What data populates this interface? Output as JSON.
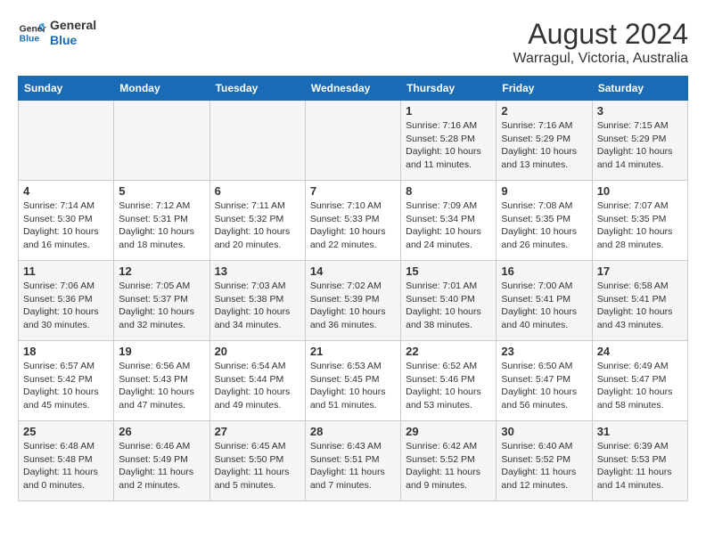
{
  "logo": {
    "line1": "General",
    "line2": "Blue"
  },
  "title": "August 2024",
  "subtitle": "Warragul, Victoria, Australia",
  "days_of_week": [
    "Sunday",
    "Monday",
    "Tuesday",
    "Wednesday",
    "Thursday",
    "Friday",
    "Saturday"
  ],
  "weeks": [
    [
      {
        "day": "",
        "info": ""
      },
      {
        "day": "",
        "info": ""
      },
      {
        "day": "",
        "info": ""
      },
      {
        "day": "",
        "info": ""
      },
      {
        "day": "1",
        "info": "Sunrise: 7:16 AM\nSunset: 5:28 PM\nDaylight: 10 hours\nand 11 minutes."
      },
      {
        "day": "2",
        "info": "Sunrise: 7:16 AM\nSunset: 5:29 PM\nDaylight: 10 hours\nand 13 minutes."
      },
      {
        "day": "3",
        "info": "Sunrise: 7:15 AM\nSunset: 5:29 PM\nDaylight: 10 hours\nand 14 minutes."
      }
    ],
    [
      {
        "day": "4",
        "info": "Sunrise: 7:14 AM\nSunset: 5:30 PM\nDaylight: 10 hours\nand 16 minutes."
      },
      {
        "day": "5",
        "info": "Sunrise: 7:12 AM\nSunset: 5:31 PM\nDaylight: 10 hours\nand 18 minutes."
      },
      {
        "day": "6",
        "info": "Sunrise: 7:11 AM\nSunset: 5:32 PM\nDaylight: 10 hours\nand 20 minutes."
      },
      {
        "day": "7",
        "info": "Sunrise: 7:10 AM\nSunset: 5:33 PM\nDaylight: 10 hours\nand 22 minutes."
      },
      {
        "day": "8",
        "info": "Sunrise: 7:09 AM\nSunset: 5:34 PM\nDaylight: 10 hours\nand 24 minutes."
      },
      {
        "day": "9",
        "info": "Sunrise: 7:08 AM\nSunset: 5:35 PM\nDaylight: 10 hours\nand 26 minutes."
      },
      {
        "day": "10",
        "info": "Sunrise: 7:07 AM\nSunset: 5:35 PM\nDaylight: 10 hours\nand 28 minutes."
      }
    ],
    [
      {
        "day": "11",
        "info": "Sunrise: 7:06 AM\nSunset: 5:36 PM\nDaylight: 10 hours\nand 30 minutes."
      },
      {
        "day": "12",
        "info": "Sunrise: 7:05 AM\nSunset: 5:37 PM\nDaylight: 10 hours\nand 32 minutes."
      },
      {
        "day": "13",
        "info": "Sunrise: 7:03 AM\nSunset: 5:38 PM\nDaylight: 10 hours\nand 34 minutes."
      },
      {
        "day": "14",
        "info": "Sunrise: 7:02 AM\nSunset: 5:39 PM\nDaylight: 10 hours\nand 36 minutes."
      },
      {
        "day": "15",
        "info": "Sunrise: 7:01 AM\nSunset: 5:40 PM\nDaylight: 10 hours\nand 38 minutes."
      },
      {
        "day": "16",
        "info": "Sunrise: 7:00 AM\nSunset: 5:41 PM\nDaylight: 10 hours\nand 40 minutes."
      },
      {
        "day": "17",
        "info": "Sunrise: 6:58 AM\nSunset: 5:41 PM\nDaylight: 10 hours\nand 43 minutes."
      }
    ],
    [
      {
        "day": "18",
        "info": "Sunrise: 6:57 AM\nSunset: 5:42 PM\nDaylight: 10 hours\nand 45 minutes."
      },
      {
        "day": "19",
        "info": "Sunrise: 6:56 AM\nSunset: 5:43 PM\nDaylight: 10 hours\nand 47 minutes."
      },
      {
        "day": "20",
        "info": "Sunrise: 6:54 AM\nSunset: 5:44 PM\nDaylight: 10 hours\nand 49 minutes."
      },
      {
        "day": "21",
        "info": "Sunrise: 6:53 AM\nSunset: 5:45 PM\nDaylight: 10 hours\nand 51 minutes."
      },
      {
        "day": "22",
        "info": "Sunrise: 6:52 AM\nSunset: 5:46 PM\nDaylight: 10 hours\nand 53 minutes."
      },
      {
        "day": "23",
        "info": "Sunrise: 6:50 AM\nSunset: 5:47 PM\nDaylight: 10 hours\nand 56 minutes."
      },
      {
        "day": "24",
        "info": "Sunrise: 6:49 AM\nSunset: 5:47 PM\nDaylight: 10 hours\nand 58 minutes."
      }
    ],
    [
      {
        "day": "25",
        "info": "Sunrise: 6:48 AM\nSunset: 5:48 PM\nDaylight: 11 hours\nand 0 minutes."
      },
      {
        "day": "26",
        "info": "Sunrise: 6:46 AM\nSunset: 5:49 PM\nDaylight: 11 hours\nand 2 minutes."
      },
      {
        "day": "27",
        "info": "Sunrise: 6:45 AM\nSunset: 5:50 PM\nDaylight: 11 hours\nand 5 minutes."
      },
      {
        "day": "28",
        "info": "Sunrise: 6:43 AM\nSunset: 5:51 PM\nDaylight: 11 hours\nand 7 minutes."
      },
      {
        "day": "29",
        "info": "Sunrise: 6:42 AM\nSunset: 5:52 PM\nDaylight: 11 hours\nand 9 minutes."
      },
      {
        "day": "30",
        "info": "Sunrise: 6:40 AM\nSunset: 5:52 PM\nDaylight: 11 hours\nand 12 minutes."
      },
      {
        "day": "31",
        "info": "Sunrise: 6:39 AM\nSunset: 5:53 PM\nDaylight: 11 hours\nand 14 minutes."
      }
    ]
  ]
}
